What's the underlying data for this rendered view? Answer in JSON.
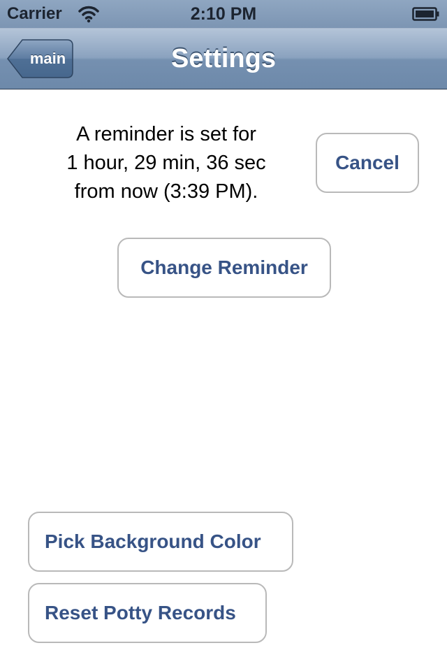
{
  "status_bar": {
    "carrier": "Carrier",
    "time": "2:10 PM",
    "icons": [
      "wifi-icon",
      "battery-icon"
    ]
  },
  "nav_bar": {
    "back_label": "main",
    "title": "Settings"
  },
  "reminder": {
    "line1": "A reminder is set for",
    "line2": "1 hour, 29 min, 36 sec",
    "line3": "from now (3:39 PM)."
  },
  "buttons": {
    "cancel": "Cancel",
    "change_reminder": "Change Reminder",
    "pick_background_color": "Pick Background Color",
    "reset_potty_records": "Reset Potty Records"
  },
  "colors": {
    "nav_bar": "#7c95b3",
    "button_text": "#375386",
    "button_border": "#b9b9b9"
  }
}
